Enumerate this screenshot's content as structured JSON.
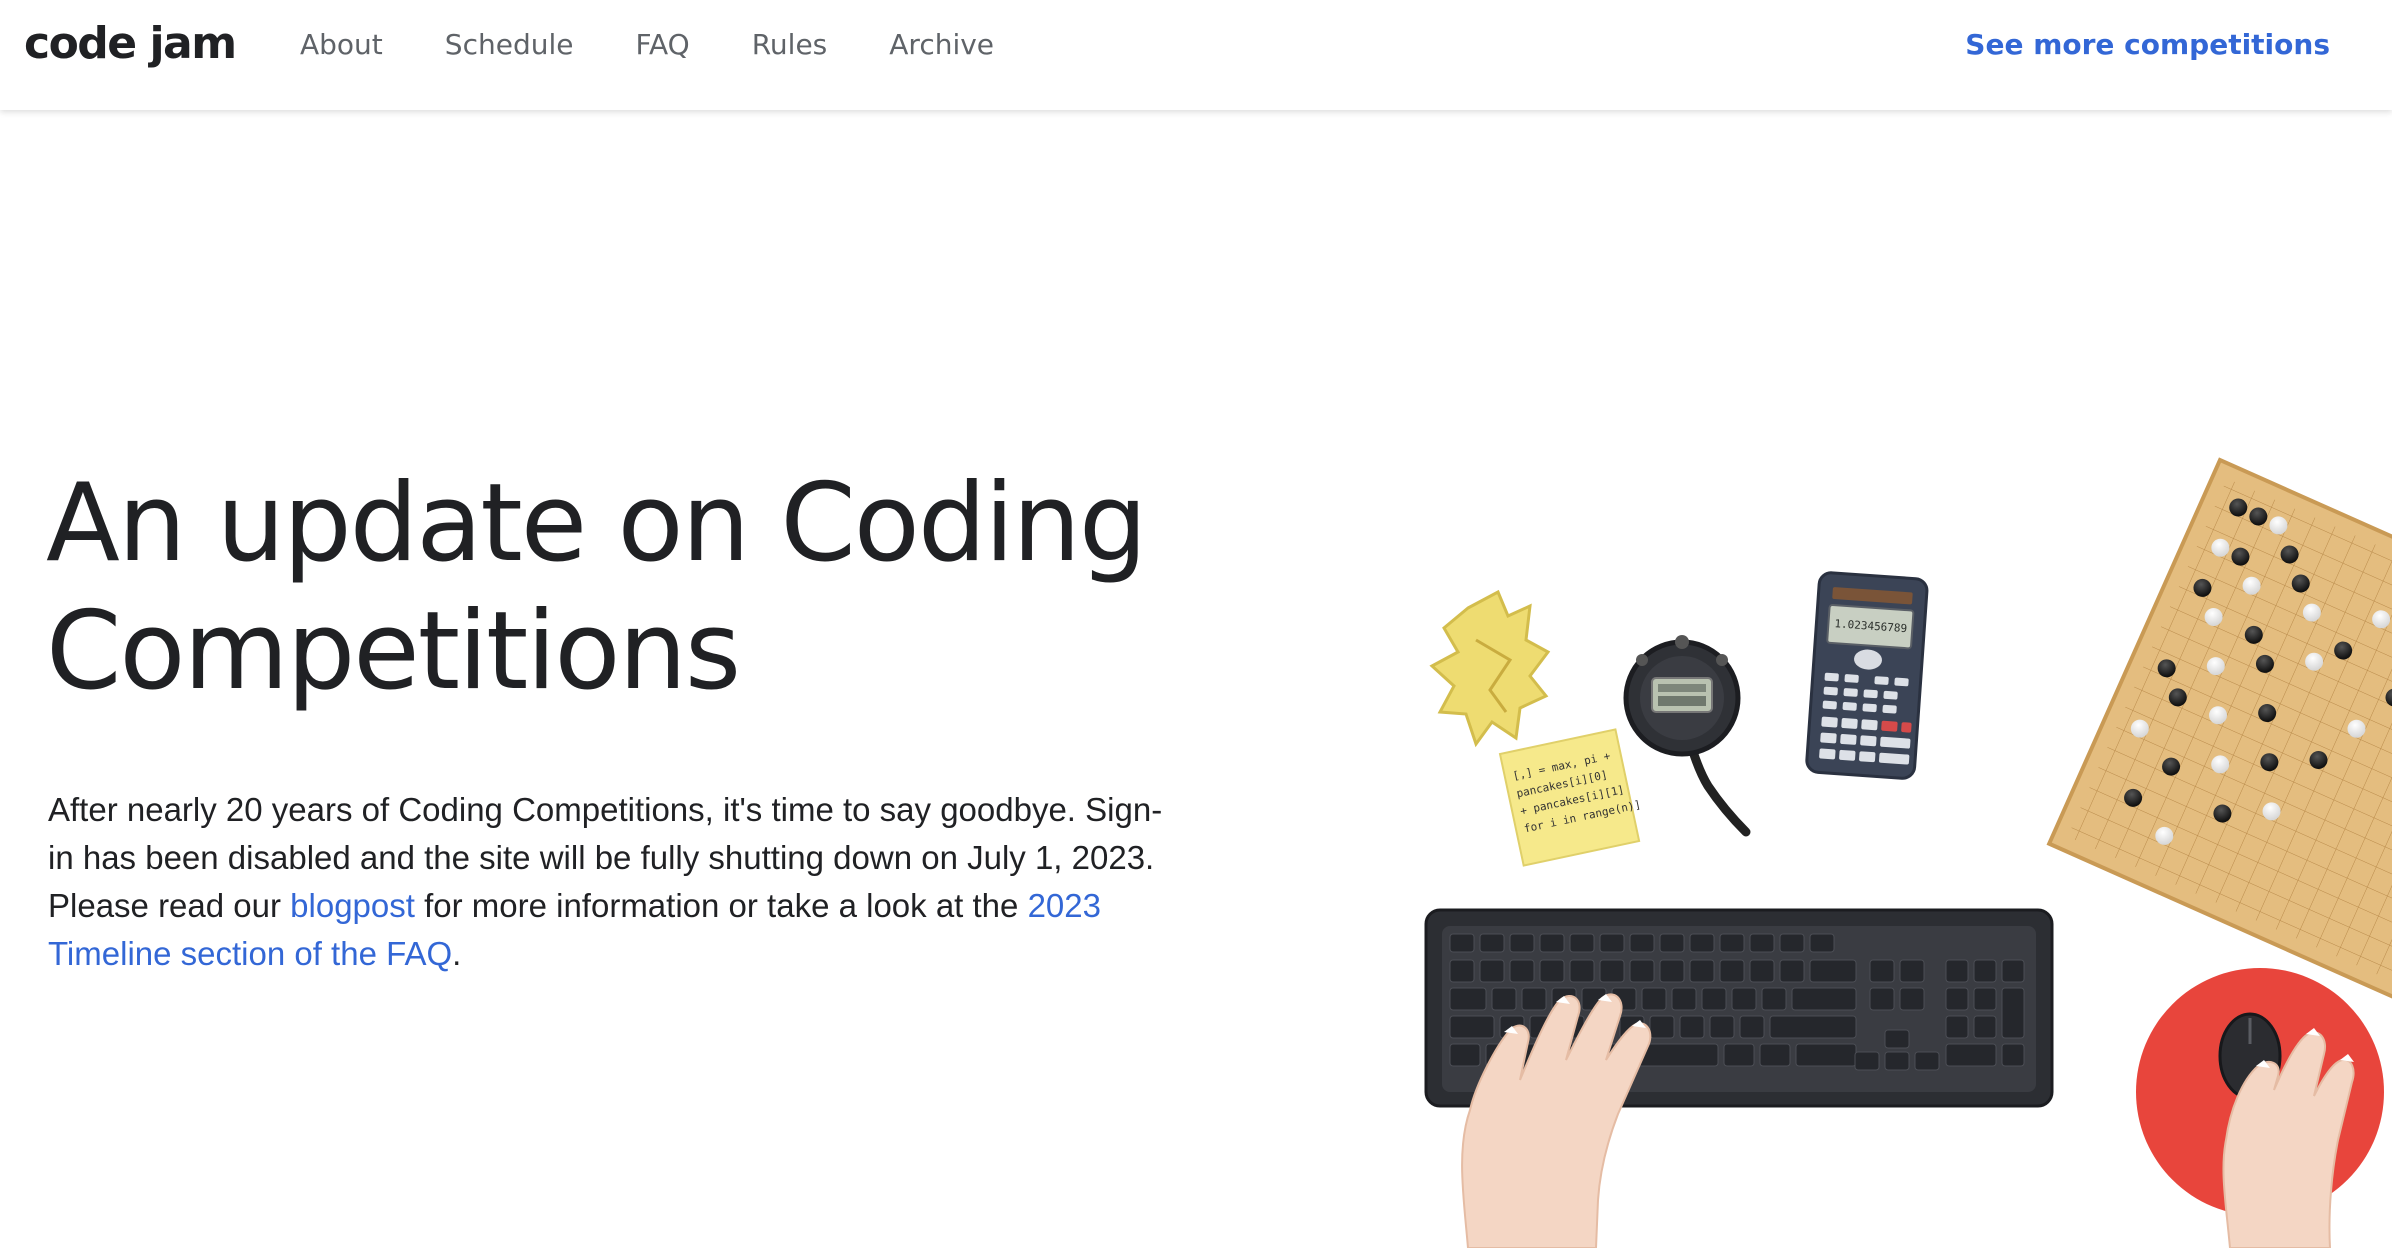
{
  "header": {
    "logo": "code jam",
    "nav": [
      "About",
      "Schedule",
      "FAQ",
      "Rules",
      "Archive"
    ],
    "cta": "See more competitions"
  },
  "hero": {
    "title_line1": "An update on Coding",
    "title_line2": "Competitions",
    "body_part1": "After nearly 20 years of Coding Competitions, it's time to say goodbye. Sign-in has been disabled and the site will be fully shutting down on July 1, 2023. Please read our ",
    "link_blogpost": "blogpost",
    "body_part2": " for more information or take a look at the ",
    "link_faq": "2023 Timeline section of the FAQ",
    "body_part3": "."
  },
  "illustration": {
    "calculator_display": "1.023456789",
    "sticky_note_lines": [
      "[,] = max, pi +",
      "pancakes[i][0]",
      "+ pancakes[i][1]",
      "for i in range(n)]"
    ]
  },
  "colors": {
    "link": "#3367d6",
    "text": "#202124",
    "nav": "#5f6368",
    "mousepad": "#e8453c"
  }
}
